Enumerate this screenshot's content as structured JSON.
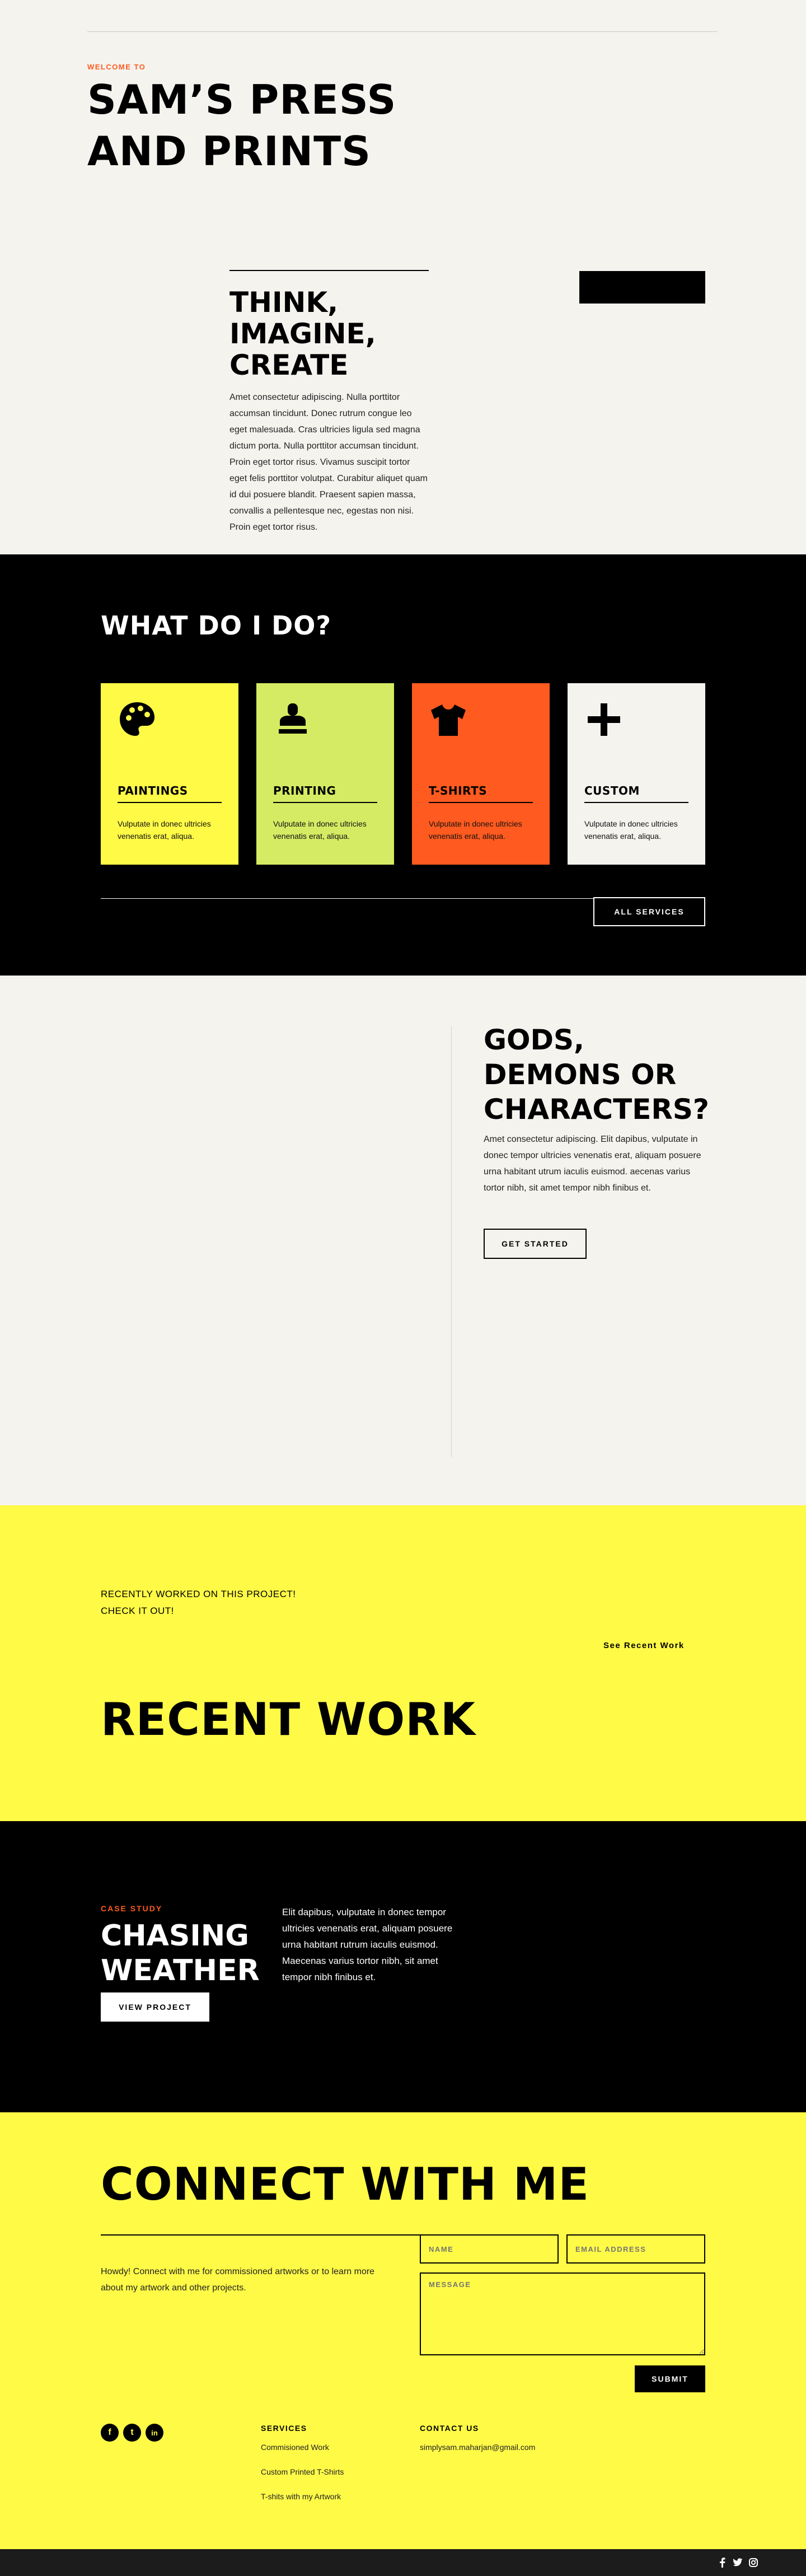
{
  "hero": {
    "eyebrow": "WELCOME TO",
    "title": "SAM’S PRESS AND PRINTS",
    "subtitle": "THINK, IMAGINE, CREATE",
    "body": "Amet consectetur adipiscing. Nulla porttitor accumsan tincidunt. Donec rutrum congue leo eget malesuada. Cras ultricies ligula sed magna dictum porta. Nulla porttitor accumsan tincidunt. Proin eget tortor risus. Vivamus suscipit tortor eget felis porttitor volutpat. Curabitur aliquet quam id dui posuere blandit. Praesent sapien massa, convallis a pellentesque nec, egestas non nisi. Proin eget tortor risus."
  },
  "services": {
    "title": "WHAT DO I DO?",
    "items": [
      {
        "label": "PAINTINGS",
        "desc": "Vulputate in donec ultricies venenatis erat, aliqua.",
        "color": "#fffa46",
        "icon": "palette-icon"
      },
      {
        "label": "PRINTING",
        "desc": "Vulputate in donec ultricies venenatis erat, aliqua.",
        "color": "#d5eb63",
        "icon": "stamp-icon"
      },
      {
        "label": "T-SHIRTS",
        "desc": "Vulputate in donec ultricies venenatis erat, aliqua.",
        "color": "#ff5a1f",
        "icon": "tshirt-icon"
      },
      {
        "label": "CUSTOM",
        "desc": "Vulputate in donec ultricies venenatis erat, aliqua.",
        "color": "#f4f3ee",
        "icon": "plus-icon"
      }
    ],
    "cta": "ALL SERVICES"
  },
  "gods": {
    "title": "GODS, DEMONS OR CHARACTERS?",
    "body": "Amet consectetur adipiscing. Elit dapibus, vulputate in donec tempor ultricies venenatis erat, aliquam posuere urna habitant utrum iaculis euismod. aecenas varius tortor nibh, sit amet tempor nibh finibus et.",
    "cta": "GET STARTED"
  },
  "recent": {
    "note_line1": "RECENTLY WORKED ON THIS PROJECT!",
    "note_line2": "CHECK IT OUT!",
    "link": "See Recent Work",
    "title": "RECENT WORK"
  },
  "case_study": {
    "eyebrow": "CASE STUDY",
    "title": "CHASING WEATHER",
    "cta": "VIEW PROJECT",
    "body": "Elit dapibus, vulputate in donec tempor ultricies venenatis erat, aliquam posuere urna habitant rutrum iaculis euismod. Maecenas varius tortor nibh, sit amet tempor nibh finibus et."
  },
  "contact": {
    "title": "CONNECT WITH ME",
    "blurb": "Howdy! Connect with me for commissioned artworks or to learn more about my artwork and other projects.",
    "name_placeholder": "NAME",
    "email_placeholder": "EMAIL ADDRESS",
    "message_placeholder": "MESSAGE",
    "submit": "SUBMIT",
    "social": [
      "f",
      "t",
      "in"
    ],
    "services_heading": "SERVICES",
    "services_links": [
      "Commisioned Work",
      "Custom Printed T-Shirts",
      "T-shits with my Artwork"
    ],
    "contact_heading": "CONTACT US",
    "email": "simplysam.maharjan@gmail.com"
  },
  "footer": {
    "icons": [
      "facebook-icon",
      "twitter-icon",
      "instagram-icon"
    ]
  },
  "colors": {
    "accent_orange": "#ff5a1f",
    "yellow": "#fffa46",
    "lime": "#d5eb63",
    "cream": "#f4f3ee",
    "black": "#000000"
  }
}
